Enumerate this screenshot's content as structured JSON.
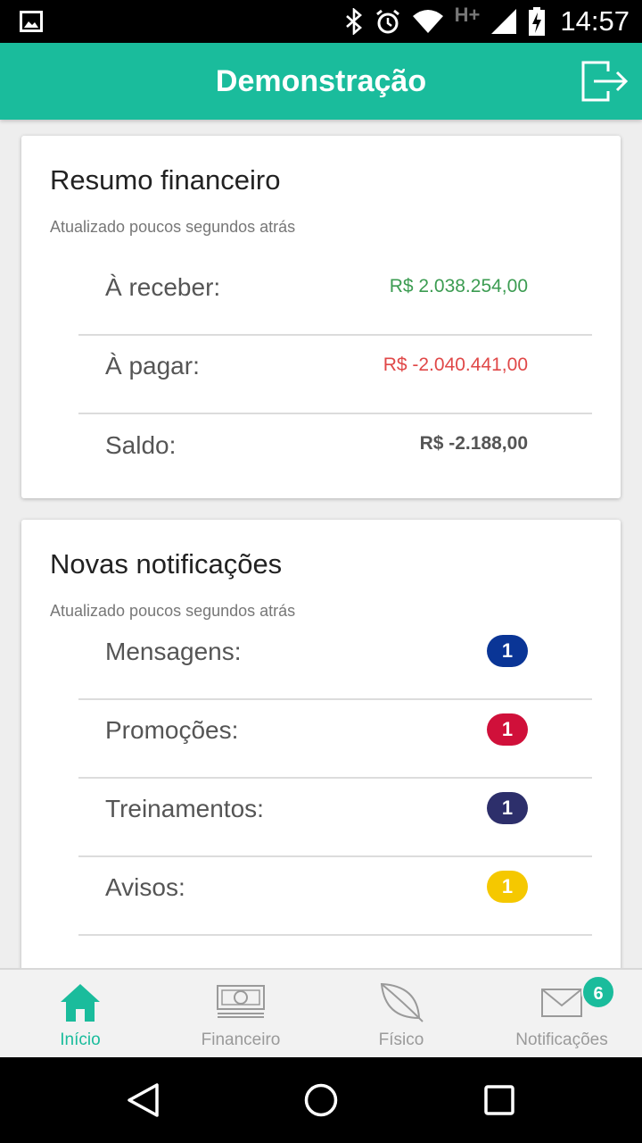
{
  "status_bar": {
    "time": "14:57",
    "network": "H+",
    "icons": [
      "image-icon",
      "bluetooth-icon",
      "alarm-icon",
      "wifi-icon",
      "signal-icon",
      "battery-charging-icon"
    ]
  },
  "app_bar": {
    "title": "Demonstração",
    "logout_icon": "logout-icon"
  },
  "finance_card": {
    "title": "Resumo financeiro",
    "subtitle": "Atualizado poucos segundos atrás",
    "rows": [
      {
        "label": "À receber:",
        "value": "R$ 2.038.254,00",
        "color": "#3c9c52"
      },
      {
        "label": "À pagar:",
        "value": "R$ -2.040.441,00",
        "color": "#e04848"
      },
      {
        "label": "Saldo:",
        "value": "R$ -2.188,00",
        "color": "#555555"
      }
    ]
  },
  "notifications_card": {
    "title": "Novas notificações",
    "subtitle": "Atualizado poucos segundos atrás",
    "rows": [
      {
        "label": "Mensagens:",
        "count": "1",
        "color": "#0a3596"
      },
      {
        "label": "Promoções:",
        "count": "1",
        "color": "#d0103a"
      },
      {
        "label": "Treinamentos:",
        "count": "1",
        "color": "#2d2f6b"
      },
      {
        "label": "Avisos:",
        "count": "1",
        "color": "#f5c800"
      }
    ]
  },
  "bottom_nav": {
    "accent_color": "#1abc9c",
    "items": [
      {
        "label": "Início",
        "icon": "home-icon",
        "active": true
      },
      {
        "label": "Financeiro",
        "icon": "money-icon",
        "active": false
      },
      {
        "label": "Físico",
        "icon": "leaf-icon",
        "active": false
      },
      {
        "label": "Notificações",
        "icon": "envelope-icon",
        "active": false,
        "badge": "6"
      }
    ]
  },
  "system_nav": {
    "icons": [
      "back-icon",
      "home-circle-icon",
      "recents-icon"
    ]
  }
}
